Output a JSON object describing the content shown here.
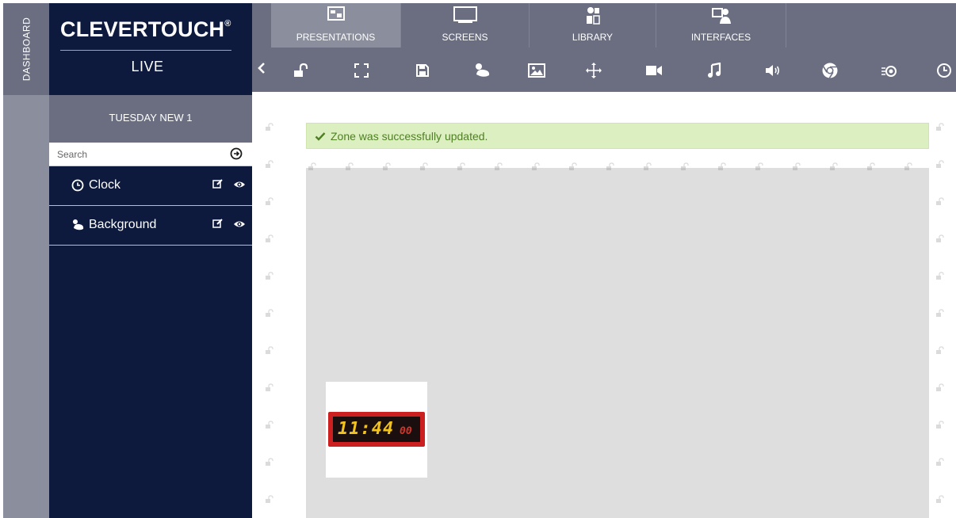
{
  "dashboard": {
    "label": "DASHBOARD"
  },
  "brand": {
    "name": "CLEVERTOUCH",
    "mark": "®",
    "sub": "LIVE"
  },
  "presentation": {
    "title": "TUESDAY NEW 1"
  },
  "search": {
    "placeholder": "Search",
    "icon": "arrow-circle-right-icon"
  },
  "layers": [
    {
      "label": "Clock",
      "icon": "clock-icon"
    },
    {
      "label": "Background",
      "icon": "paint-icon"
    }
  ],
  "nav": {
    "tabs": [
      {
        "label": "PRESENTATIONS",
        "icon": "presentations-icon",
        "active": true
      },
      {
        "label": "SCREENS",
        "icon": "screen-icon",
        "active": false
      },
      {
        "label": "LIBRARY",
        "icon": "library-icon",
        "active": false
      },
      {
        "label": "INTERFACES",
        "icon": "interfaces-icon",
        "active": false
      }
    ]
  },
  "toolbar": {
    "tools": [
      "unlock-icon",
      "fullscreen-icon",
      "save-icon",
      "background-icon",
      "image-icon",
      "move-icon",
      "video-icon",
      "music-icon",
      "volume-icon",
      "chrome-icon",
      "rss-icon",
      "clock-icon"
    ]
  },
  "alert": {
    "text": "Zone was successfully updated."
  },
  "clock": {
    "hours_minutes": "11:44",
    "seconds": "00"
  },
  "colors": {
    "sidebar": "#0d1a3d",
    "nav": "#6a6e80",
    "nav_active": "#8b8e9c",
    "alert_bg": "#dcefc0",
    "alert_text": "#4f7f24",
    "clock_frame": "#cc1f1f",
    "clock_digits": "#f2c21d"
  }
}
